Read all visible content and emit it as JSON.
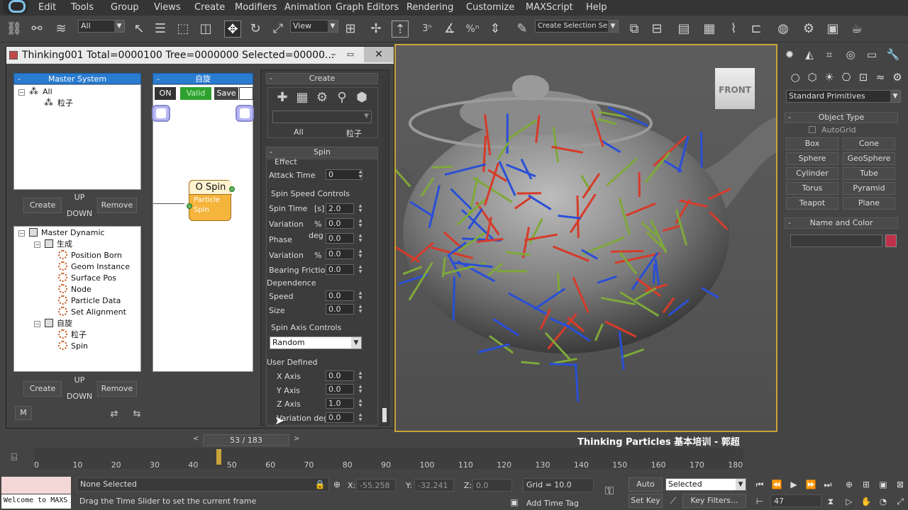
{
  "menubar": {
    "items": [
      "Edit",
      "Tools",
      "Group",
      "Views",
      "Create",
      "Modifiers",
      "Animation",
      "Graph Editors",
      "Rendering",
      "Customize",
      "MAXScript",
      "Help"
    ]
  },
  "toolbar": {
    "filter_select": "All",
    "ref_coord_select": "View",
    "named_selection": "Create Selection Se"
  },
  "tp_window": {
    "title": "Thinking001  Total=0000100  Tree=0000000  Selected=00000...",
    "master_system": {
      "header": "Master System",
      "tree": [
        {
          "label": "All"
        },
        {
          "label": "粒子"
        }
      ],
      "buttons": {
        "create": "Create",
        "up": "UP",
        "down": "DOWN",
        "remove": "Remove"
      }
    },
    "master_dynamic": {
      "tree": [
        {
          "label": "Master Dynamic"
        },
        {
          "label": "生成"
        },
        {
          "label": "Position Born"
        },
        {
          "label": "Geom Instance"
        },
        {
          "label": "Surface Pos"
        },
        {
          "label": "Node"
        },
        {
          "label": "Particle Data"
        },
        {
          "label": "Set Alignment"
        },
        {
          "label": "自旋"
        },
        {
          "label": "粒子"
        },
        {
          "label": "Spin"
        }
      ],
      "buttons": {
        "create": "Create",
        "up": "UP",
        "down": "DOWN",
        "remove": "Remove",
        "m": "M"
      }
    },
    "graph": {
      "header": "自旋",
      "on_btn": "ON",
      "valid_btn": "Valid",
      "save_btn": "Save",
      "node": {
        "title": "O Spin",
        "line1": "Particle",
        "line2": "Spin"
      }
    },
    "create_panel": {
      "header": "Create",
      "tabs": [
        "All",
        "粒子"
      ]
    },
    "spin_panel": {
      "header": "Spin",
      "effect_label": "Effect",
      "attack_time_label": "Attack Time",
      "attack_time": "0",
      "speed_group": "Spin Speed Controls",
      "spin_time_label": "Spin Time",
      "spin_time_unit": "[s]",
      "spin_time": "2.0",
      "variation1_label": "Variation",
      "variation1_unit": "%",
      "variation1": "0.0",
      "phase_label": "Phase",
      "phase_unit": "deg",
      "phase": "0.0",
      "variation2_label": "Variation",
      "variation2_unit": "%",
      "variation2": "0.0",
      "bearing_label": "Bearing Friction",
      "bearing": "0.0",
      "dependence_label": "Dependence",
      "speed_label": "Speed",
      "speed": "0.0",
      "size_label": "Size",
      "size": "0.0",
      "axis_group": "Spin Axis Controls",
      "axis_mode": "Random",
      "user_defined_label": "User Defined",
      "x_axis_label": "X Axis",
      "x_axis": "0.0",
      "y_axis_label": "Y Axis",
      "y_axis": "0.0",
      "z_axis_label": "Z Axis",
      "z_axis": "1.0",
      "variation_deg_label": "Variation deg",
      "variation_deg": "0.0"
    }
  },
  "viewport": {
    "viewcube_label": "FRONT"
  },
  "command_panel": {
    "category_select": "Standard Primitives",
    "object_type_header": "Object Type",
    "autogrid": "AutoGrid",
    "primitives": [
      "Box",
      "Cone",
      "Sphere",
      "GeoSphere",
      "Cylinder",
      "Tube",
      "Torus",
      "Pyramid",
      "Teapot",
      "Plane"
    ],
    "name_color_header": "Name and Color",
    "object_color": "#c0304a"
  },
  "timeline": {
    "frame_readout": "53 / 183",
    "current_frame": 53,
    "total_frames": 183,
    "ticks": [
      "0",
      "10",
      "20",
      "30",
      "40",
      "50",
      "60",
      "70",
      "80",
      "90",
      "100",
      "110",
      "120",
      "130",
      "140",
      "150",
      "160",
      "170",
      "180"
    ],
    "caption": "Thinking Particles 基本培训 - 郭超"
  },
  "statusbar": {
    "maxscript_listener": "Welcome to MAXS",
    "selection_status": "None Selected",
    "prompt": "Drag the Time Slider to set the current frame",
    "x_label": "X:",
    "x_value": "-55.258",
    "y_label": "Y:",
    "y_value": "-32.241",
    "z_label": "Z:",
    "z_value": "0.0",
    "grid": "Grid = 10.0",
    "add_time_tag": "Add Time Tag",
    "auto_key": "Auto Key",
    "set_key": "Set Key",
    "key_mode": "Selected",
    "key_filters": "Key Filters...",
    "frame_field": "47"
  }
}
